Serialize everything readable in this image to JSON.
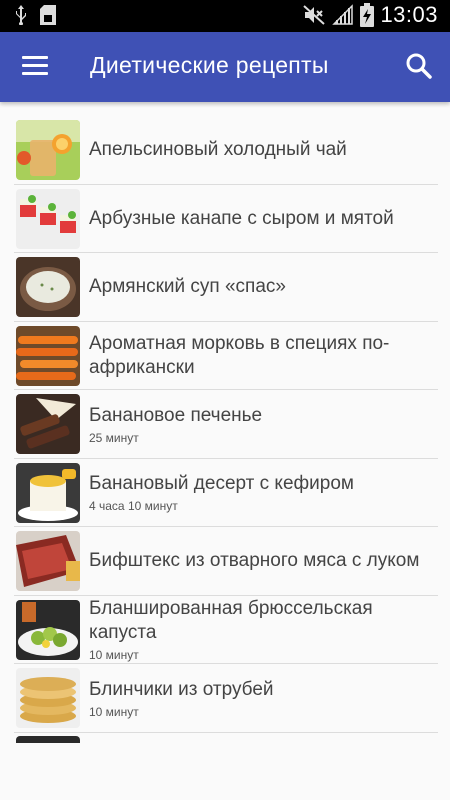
{
  "status": {
    "time": "13:03"
  },
  "appbar": {
    "title": "Диетические рецепты"
  },
  "icons": {
    "menu": "menu-icon",
    "search": "search-icon",
    "usb": "usb-icon",
    "sdcard": "sd-card-icon",
    "mute": "mute-icon",
    "signal": "signal-icon",
    "battery": "battery-charging-icon"
  },
  "colors": {
    "primary": "#3f51b5",
    "background": "#fafafa",
    "divider": "#dcdcdc"
  },
  "recipes": [
    {
      "name": "Апельсиновый холодный чай",
      "time": ""
    },
    {
      "name": "Арбузные канапе с сыром и мятой",
      "time": ""
    },
    {
      "name": "Армянский суп «спас»",
      "time": ""
    },
    {
      "name": "Ароматная морковь в специях по-африкански",
      "time": ""
    },
    {
      "name": "Банановое печенье",
      "time": "25 минут"
    },
    {
      "name": "Банановый десерт с кефиром",
      "time": "4 часа 10 минут"
    },
    {
      "name": "Бифштекс из отварного мяса с луком",
      "time": ""
    },
    {
      "name": "Бланшированная брюссельская капуста",
      "time": "10 минут"
    },
    {
      "name": "Блинчики из отрубей",
      "time": "10 минут"
    }
  ]
}
